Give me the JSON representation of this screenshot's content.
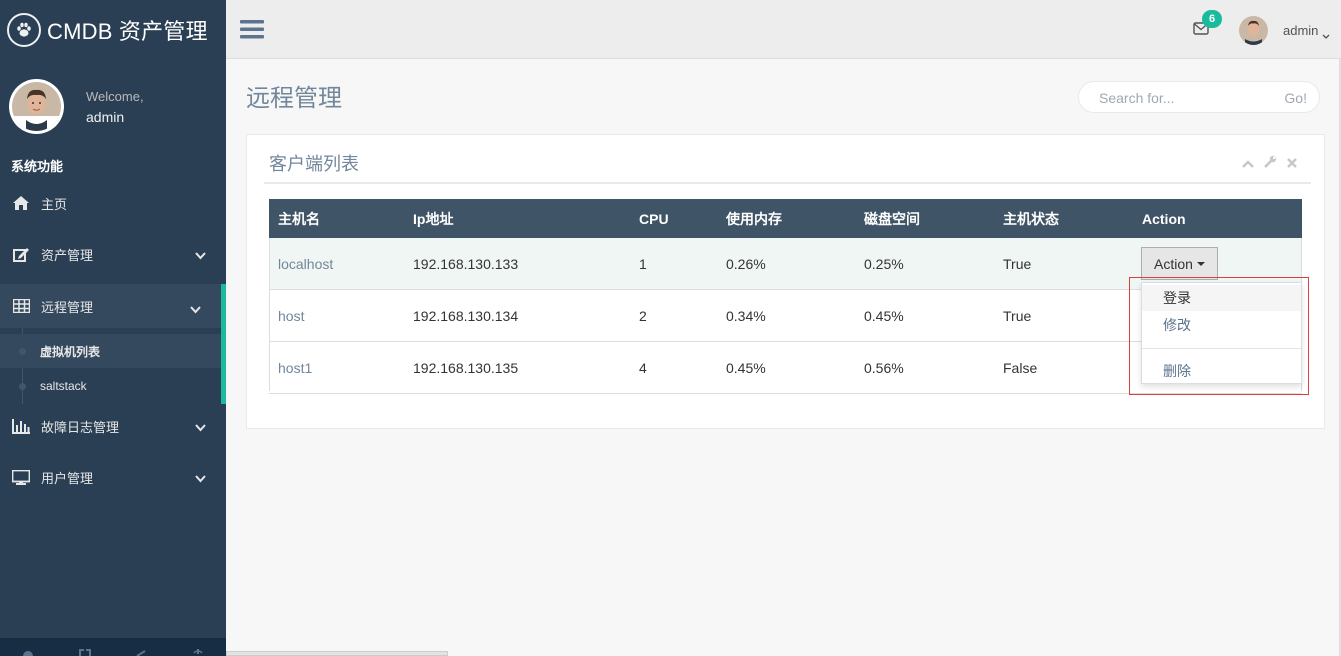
{
  "brand": {
    "title": "CMDB 资产管理",
    "icon": "paw-icon"
  },
  "profile": {
    "welcome": "Welcome,",
    "username": "admin"
  },
  "sidebar": {
    "section_title": "系统功能",
    "items": [
      {
        "label": "主页",
        "icon": "home-icon"
      },
      {
        "label": "资产管理",
        "icon": "edit-icon"
      },
      {
        "label": "远程管理",
        "icon": "table-icon"
      },
      {
        "label": "故障日志管理",
        "icon": "bar-chart-icon"
      },
      {
        "label": "用户管理",
        "icon": "desktop-icon"
      }
    ],
    "sub_items": [
      {
        "label": "虚拟机列表"
      },
      {
        "label": "saltstack"
      }
    ]
  },
  "topnav": {
    "notifications": "6",
    "user": "admin"
  },
  "page": {
    "title": "远程管理"
  },
  "search": {
    "placeholder": "Search for...",
    "button": "Go!"
  },
  "panel": {
    "title": "客户端列表"
  },
  "table": {
    "headers": [
      "主机名",
      "Ip地址",
      "CPU",
      "使用内存",
      "磁盘空间",
      "主机状态",
      "Action"
    ],
    "rows": [
      [
        "localhost",
        "192.168.130.133",
        "1",
        "0.26%",
        "0.25%",
        "True"
      ],
      [
        "host",
        "192.168.130.134",
        "2",
        "0.34%",
        "0.45%",
        "True"
      ],
      [
        "host1",
        "192.168.130.135",
        "4",
        "0.45%",
        "0.56%",
        "False"
      ]
    ]
  },
  "action_button": {
    "label": "Action"
  },
  "dropdown": {
    "items": [
      "登录",
      "修改",
      "删除"
    ]
  },
  "colors": {
    "sidebar": "#2A3F54",
    "accent": "#1ABB9C",
    "table_header": "#405467",
    "highlight": "#D9413F"
  }
}
